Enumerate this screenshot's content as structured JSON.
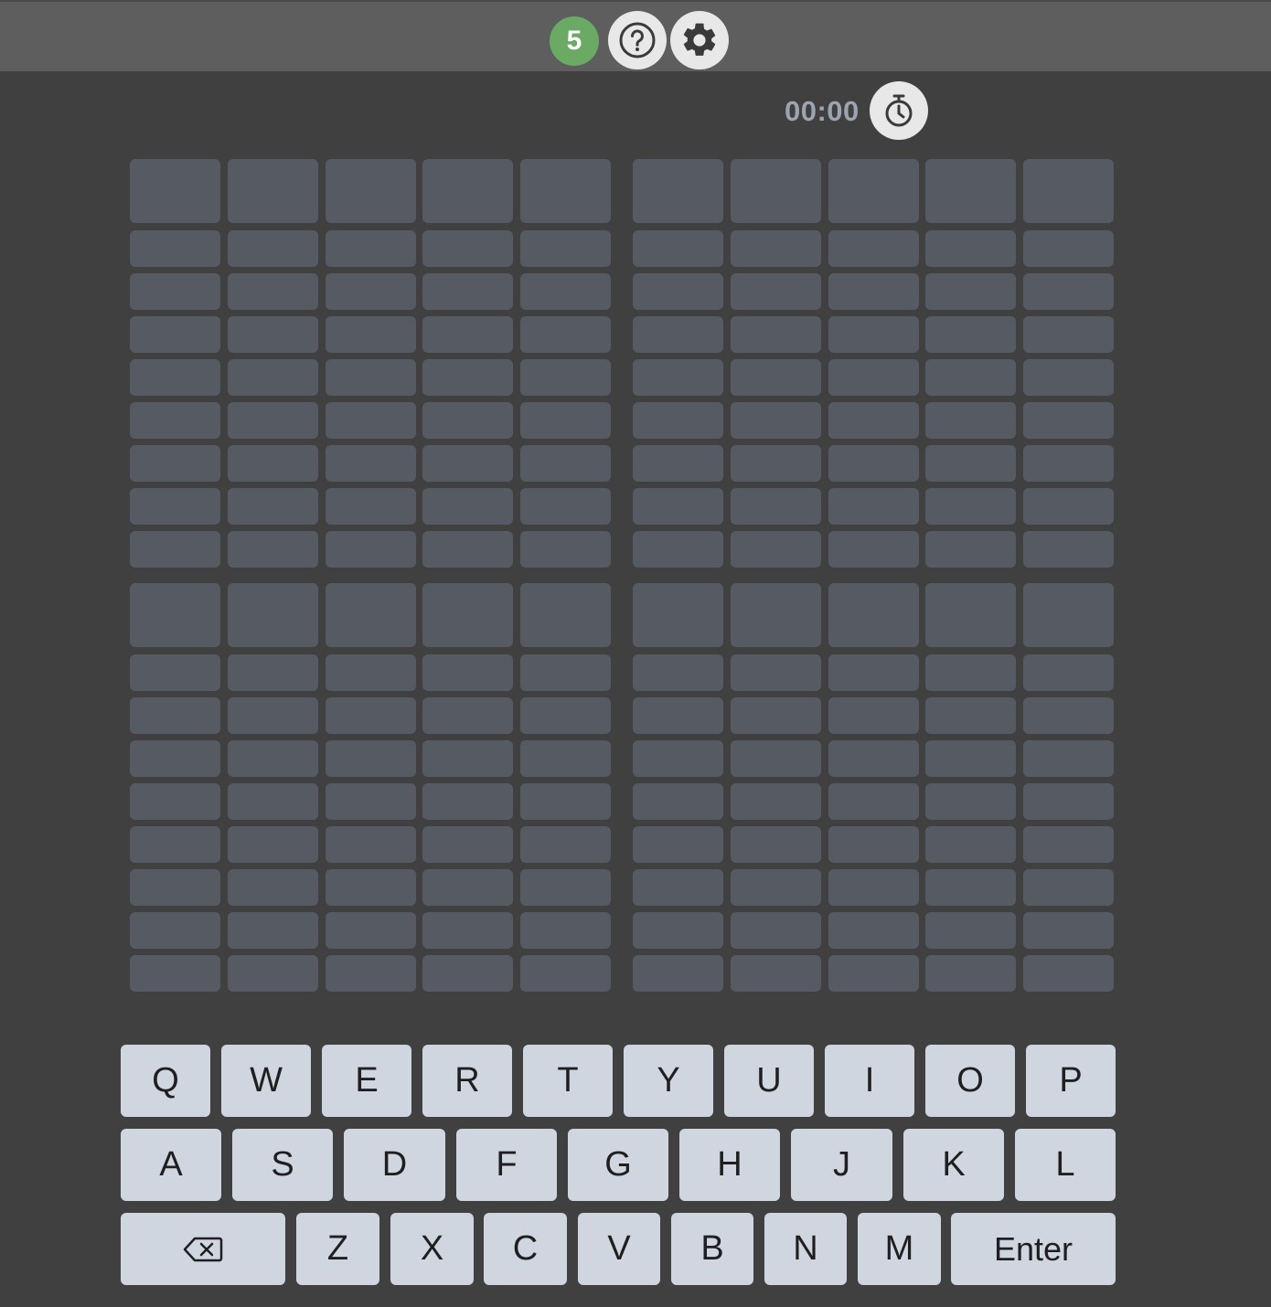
{
  "header": {
    "streak": "5",
    "help_icon": "question-circle-icon",
    "settings_icon": "gear-icon"
  },
  "timer": {
    "value": "00:00",
    "icon": "stopwatch-icon"
  },
  "board": {
    "boards": 4,
    "columns_per_board": 5,
    "rows_per_board": 9,
    "tile_color": "#565a63"
  },
  "keyboard": {
    "rows": [
      [
        "Q",
        "W",
        "E",
        "R",
        "T",
        "Y",
        "U",
        "I",
        "O",
        "P"
      ],
      [
        "A",
        "S",
        "D",
        "F",
        "G",
        "H",
        "J",
        "K",
        "L"
      ],
      [
        "⌫",
        "Z",
        "X",
        "C",
        "V",
        "B",
        "N",
        "M",
        "Enter"
      ]
    ],
    "backspace_icon": "backspace-icon",
    "key_color": "#d0d6e0"
  },
  "colors": {
    "background": "#404040",
    "header": "#5e5e5e",
    "streak_badge": "#6aaa64"
  }
}
